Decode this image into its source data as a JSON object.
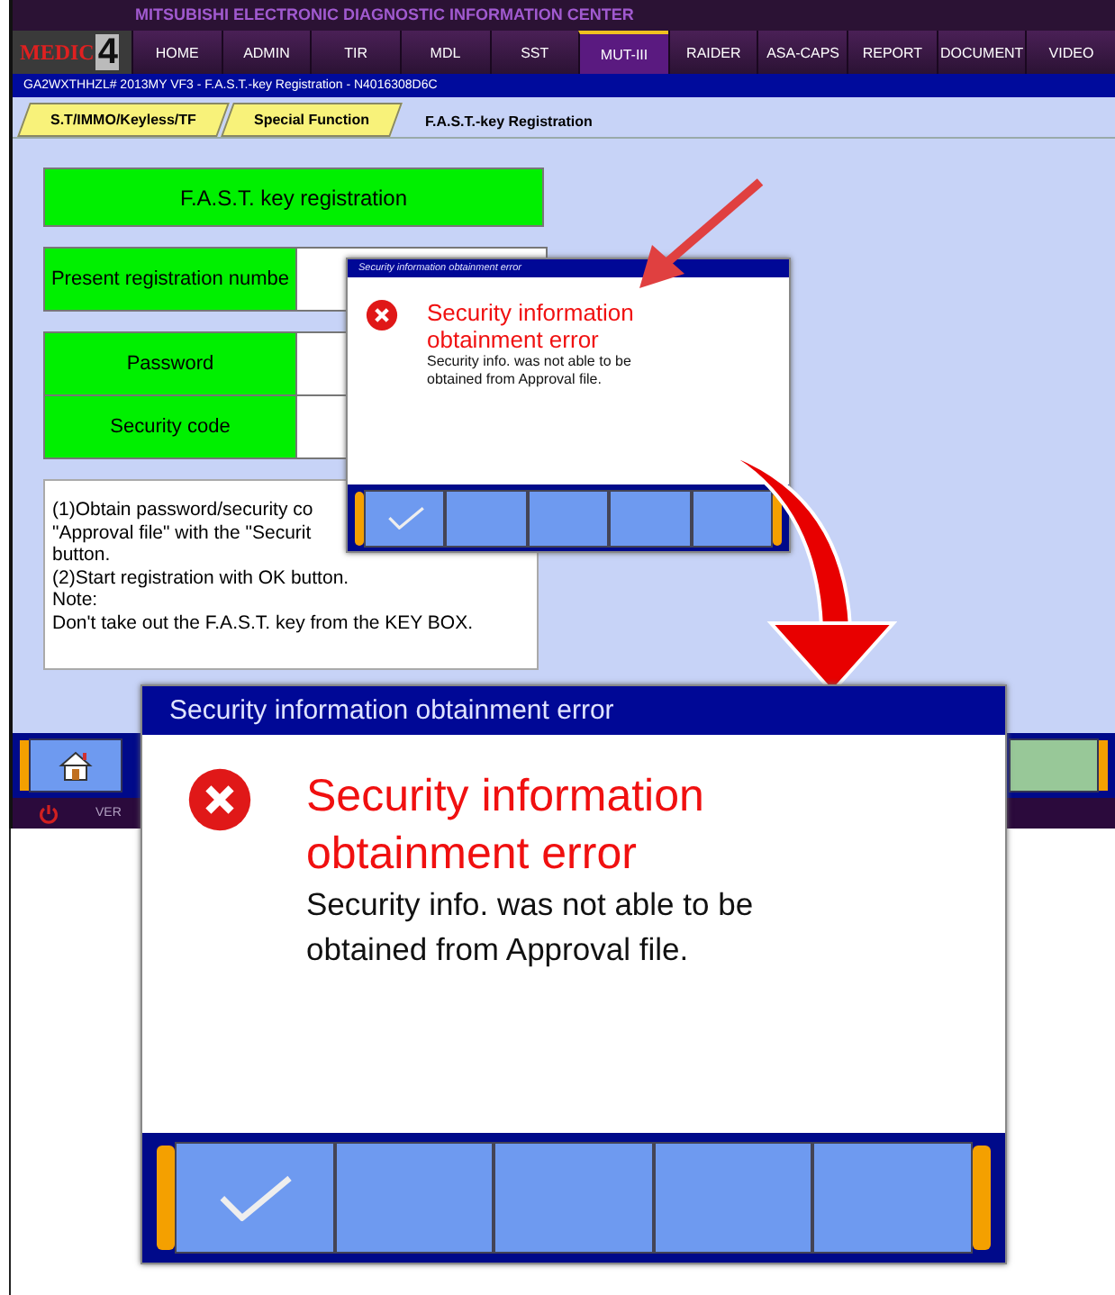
{
  "header": {
    "banner": "MITSUBISHI ELECTRONIC DIAGNOSTIC INFORMATION CENTER",
    "logo": "MEDIC",
    "logo_number": "4",
    "nav": [
      {
        "label": "HOME",
        "selected": false
      },
      {
        "label": "ADMIN",
        "selected": false
      },
      {
        "label": "TIR",
        "selected": false
      },
      {
        "label": "MDL",
        "selected": false
      },
      {
        "label": "SST",
        "selected": false
      },
      {
        "label": "MUT-III",
        "selected": true
      },
      {
        "label": "RAIDER",
        "selected": false
      },
      {
        "label": "ASA-CAPS",
        "selected": false
      },
      {
        "label": "REPORT",
        "selected": false
      },
      {
        "label": "DOCUMENT",
        "selected": false
      },
      {
        "label": "VIDEO",
        "selected": false
      }
    ]
  },
  "breadcrumb": "GA2WXTHHZL# 2013MY VF3  -  F.A.S.T.-key Registration  -  N4016308D6C",
  "tabs": [
    {
      "label": "S.T/IMMO/Keyless/TF",
      "selected": false
    },
    {
      "label": "Special Function",
      "selected": false
    },
    {
      "label": "F.A.S.T.-key Registration",
      "selected": true
    }
  ],
  "registration_button": "F.A.S.T. key registration",
  "fields": [
    {
      "label": "Present registration numbe"
    },
    {
      "label": "Password"
    },
    {
      "label": "Security code"
    }
  ],
  "instructions": [
    "(1)Obtain password/security co",
    "\"Approval file\" with the \"Securit",
    "button.",
    "(2)Start registration with OK button.",
    "Note:",
    "Don't take out the F.A.S.T. key from the KEY BOX."
  ],
  "status_bar": {
    "version": "VER"
  },
  "dialogs": [
    {
      "title": "Security information obtainment error",
      "heading": "Security information obtainment error",
      "message": "Security info. was not able to be obtained from Approval file.",
      "buttons": [
        {
          "kind": "ok"
        },
        {
          "kind": "blank"
        },
        {
          "kind": "blank"
        },
        {
          "kind": "blank"
        },
        {
          "kind": "blank"
        }
      ]
    },
    {
      "title": "Security information obtainment error",
      "heading": "Security information obtainment error",
      "message": "Security info. was not able to be obtained from Approval file.",
      "buttons": [
        {
          "kind": "ok"
        },
        {
          "kind": "blank"
        },
        {
          "kind": "blank"
        },
        {
          "kind": "blank"
        },
        {
          "kind": "blank"
        }
      ]
    }
  ]
}
